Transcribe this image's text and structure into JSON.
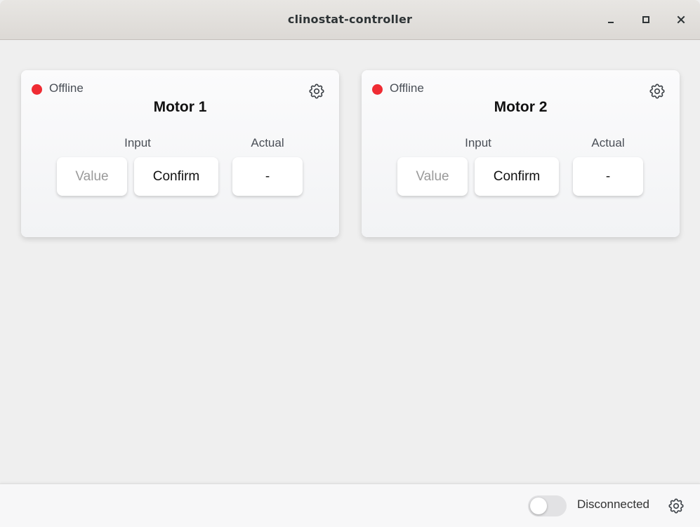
{
  "window": {
    "title": "clinostat-controller"
  },
  "motors": [
    {
      "name": "Motor 1",
      "status": "Offline",
      "status_color": "#ef2b33",
      "input_label": "Input",
      "actual_label": "Actual",
      "value_placeholder": "Value",
      "value": "",
      "confirm_label": "Confirm",
      "actual_value": "-",
      "settings_icon": "gear-icon"
    },
    {
      "name": "Motor 2",
      "status": "Offline",
      "status_color": "#ef2b33",
      "input_label": "Input",
      "actual_label": "Actual",
      "value_placeholder": "Value",
      "value": "",
      "confirm_label": "Confirm",
      "actual_value": "-",
      "settings_icon": "gear-icon"
    }
  ],
  "footer": {
    "connection_status": "Disconnected",
    "connection_toggle_on": false,
    "settings_icon": "gear-icon"
  }
}
